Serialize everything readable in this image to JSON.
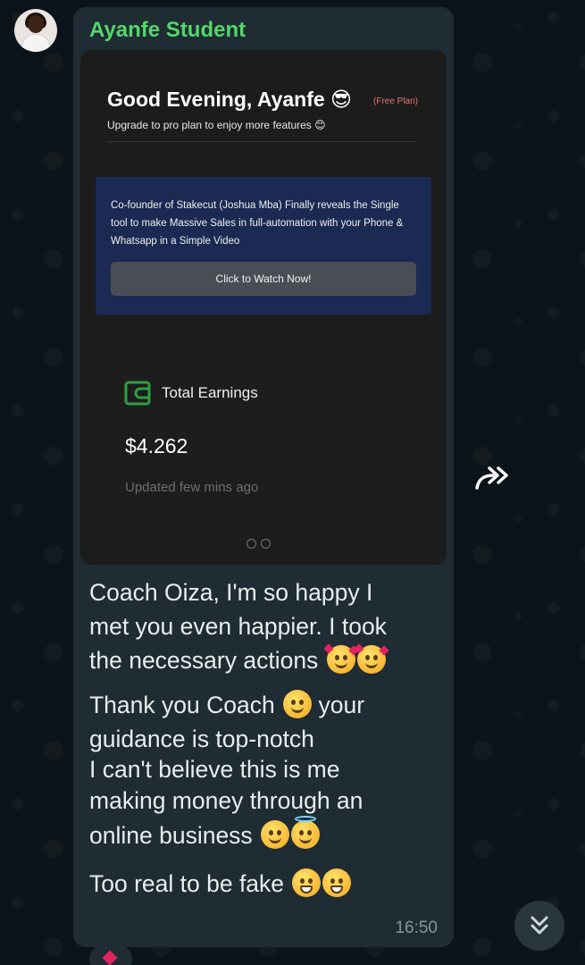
{
  "message": {
    "sender": "Ayanfe Student",
    "time": "16:50",
    "screenshot": {
      "greeting": "Good Evening, Ayanfe",
      "greeting_emoji": "😎",
      "plan_tag": "(Free Plan)",
      "subtitle": "Upgrade to pro plan to enjoy more features 😊",
      "promo_text": "Co-founder of Stakecut (Joshua Mba) Finally reveals the Single tool to make Massive Sales in full-automation with your Phone & Whatsapp in a Simple Video",
      "promo_button": "Click to Watch Now!",
      "earnings_label": "Total Earnings",
      "earnings_value": "$4.262",
      "earnings_updated": "Updated few mins ago"
    },
    "text": {
      "line1": "Coach Oiza, I'm so happy I",
      "line2": "met you even happier. I took",
      "line3": "the necessary actions",
      "line4": "Thank you Coach",
      "line4b": "your",
      "line5": "guidance is top-notch",
      "line6": "I can't believe this is me",
      "line7": "making money through an",
      "line8": "online business",
      "line9": "Too real to be fake"
    }
  },
  "icons": {
    "forward": "forward-icon",
    "scroll_down": "double-chevron-down-icon",
    "wallet": "wallet-icon"
  },
  "colors": {
    "sender": "#53d769",
    "bubble": "#1f2c33",
    "background": "#0b141a",
    "promo": "#1b2a52",
    "wallet": "#2ea043",
    "plan_tag": "#e57373"
  }
}
